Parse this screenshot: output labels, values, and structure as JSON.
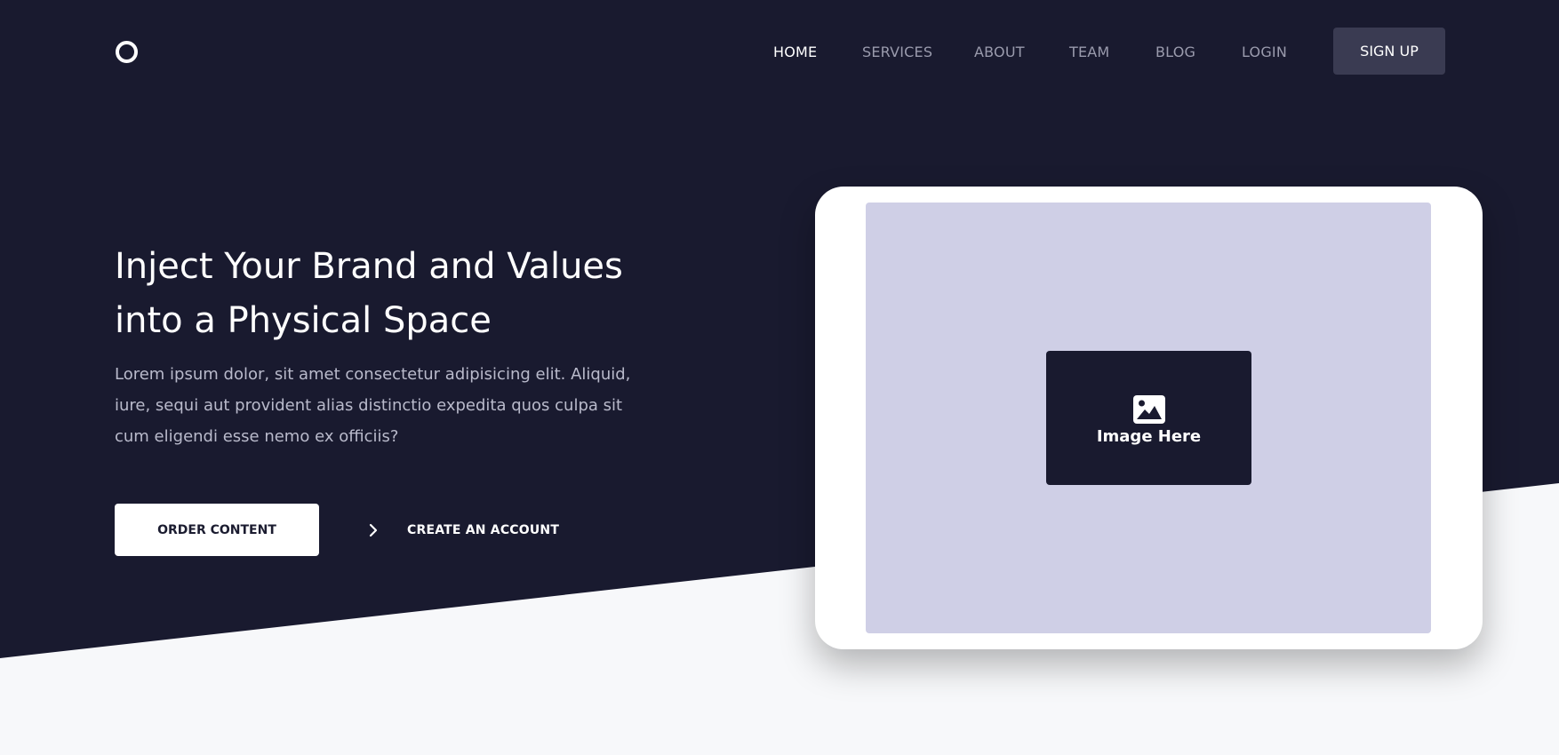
{
  "nav": {
    "items": [
      {
        "label": "HOME",
        "active": true
      },
      {
        "label": "SERVICES",
        "active": false
      },
      {
        "label": "ABOUT",
        "active": false
      },
      {
        "label": "TEAM",
        "active": false
      },
      {
        "label": "BLOG",
        "active": false
      },
      {
        "label": "LOGIN",
        "active": false
      }
    ],
    "signup_label": "SIGN UP"
  },
  "hero": {
    "title_lines": [
      "Inject Your Brand and Values",
      "into a Physical Space"
    ],
    "description_lines": [
      "Lorem ipsum dolor, sit amet consectetur adipisicing elit. Aliquid,",
      "iure, sequi aut provident alias distinctio expedita quos culpa sit",
      "cum eligendi esse nemo ex officiis?"
    ],
    "primary_button": "ORDER CONTENT",
    "secondary_link": "CREATE AN ACCOUNT"
  },
  "mockup": {
    "placeholder_label": "Image Here"
  },
  "icons": {
    "logo": "circle-logo-icon",
    "secondary_link": "chevron-right-icon",
    "placeholder": "image-icon"
  },
  "colors": {
    "hero_background": "#191a2f",
    "page_background": "#f7f8fa",
    "signup_button": "#3a3b52",
    "screen": "#cfcfe6",
    "nav_inactive": "#9a9bad"
  }
}
